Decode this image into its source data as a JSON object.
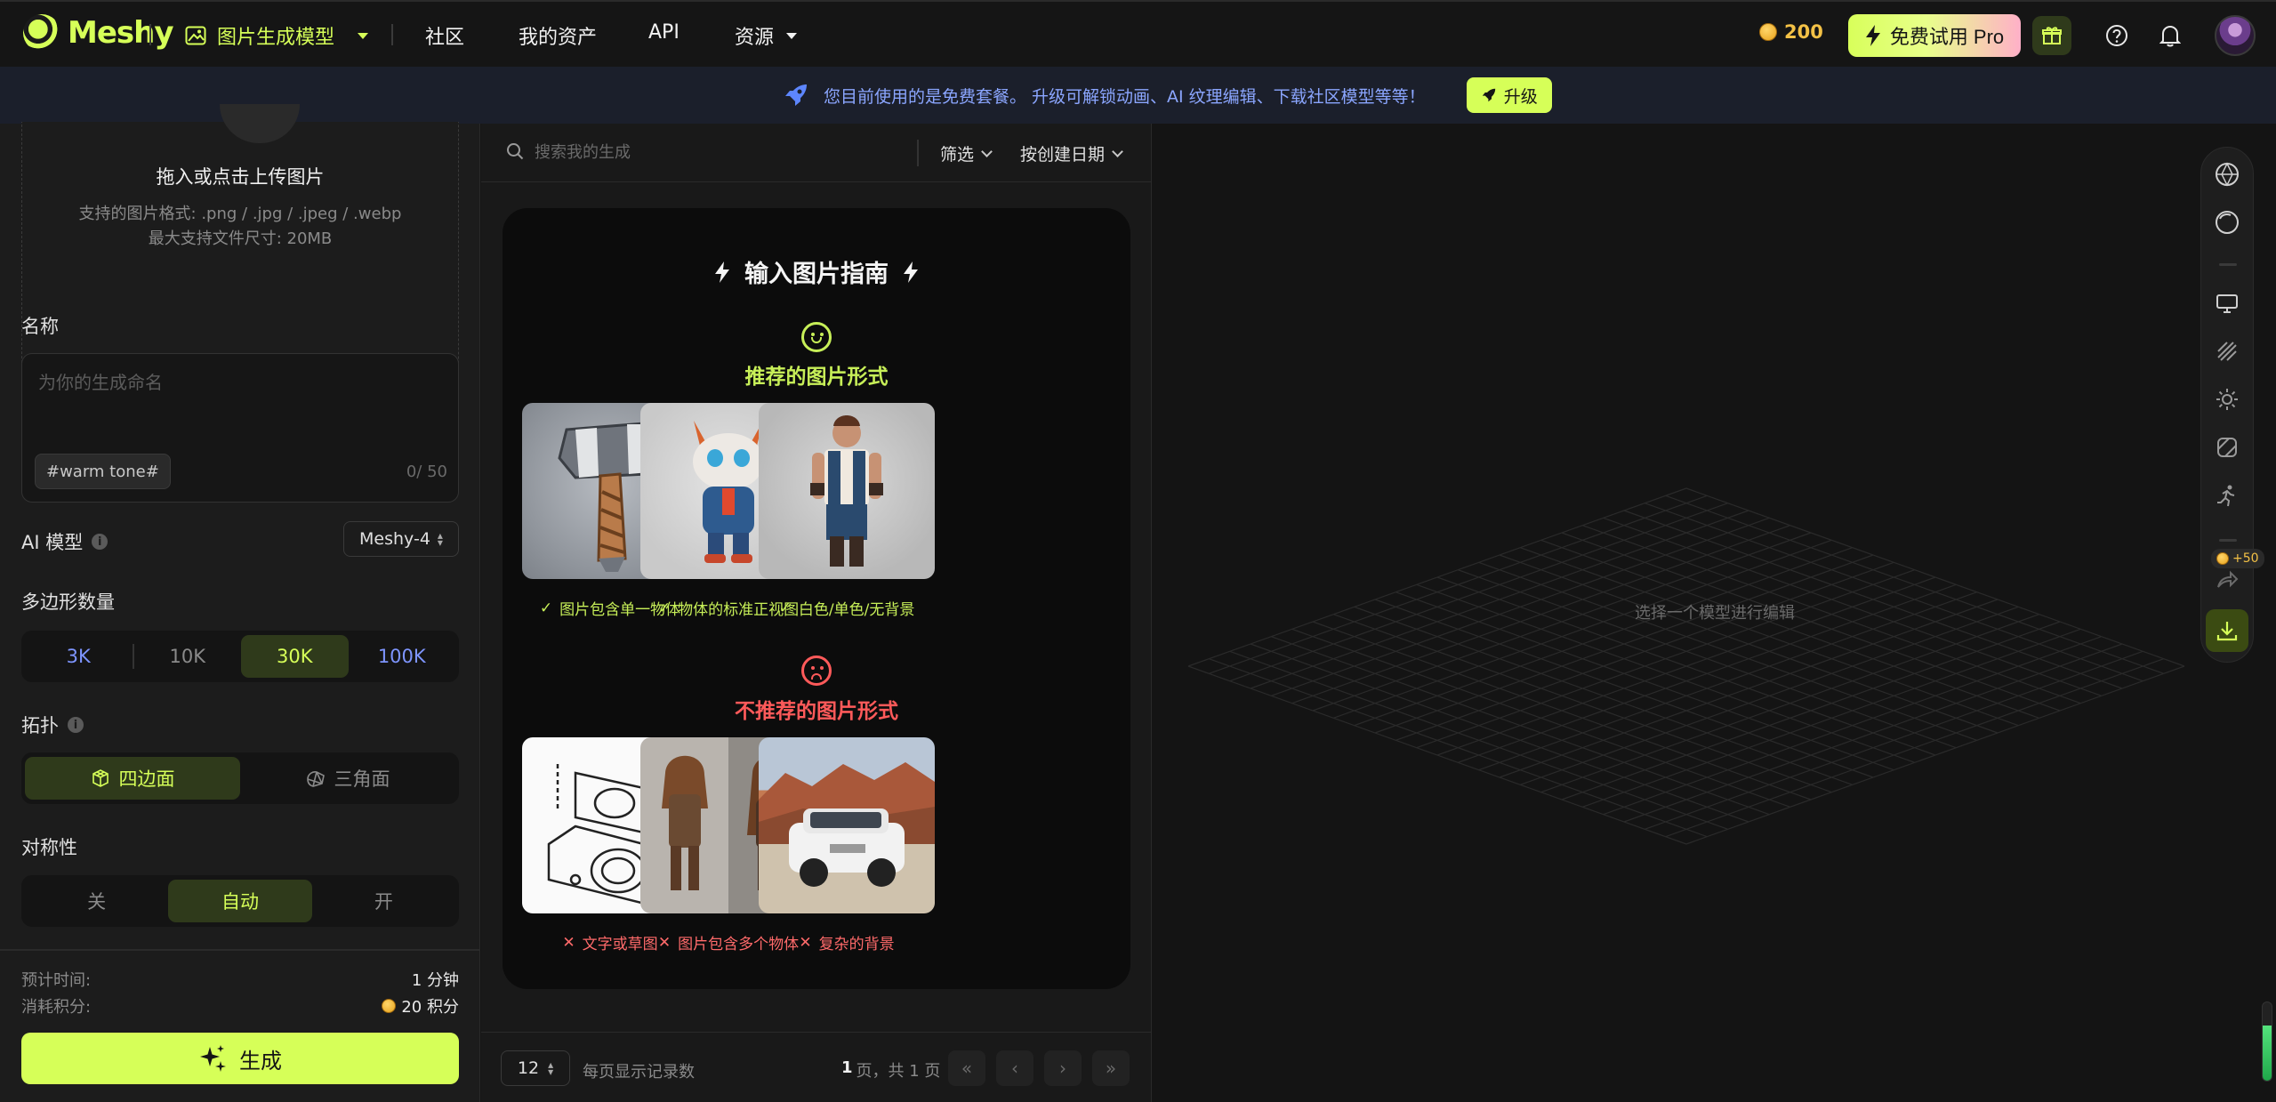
{
  "nav": {
    "logo_text": "Meshy",
    "gen_mode": "图片生成模型",
    "items": [
      "社区",
      "我的资产",
      "API",
      "资源"
    ],
    "credits": "200",
    "pro_label": "免费试用 Pro"
  },
  "banner": {
    "text": "您目前使用的是免费套餐。 升级可解锁动画、AI 纹理编辑、下载社区模型等等！",
    "upgrade_label": "升级"
  },
  "upload": {
    "title": "拖入或点击上传图片",
    "formats": "支持的图片格式: .png / .jpg / .jpeg / .webp",
    "max_size": "最大支持文件尺寸: 20MB"
  },
  "form": {
    "name_label": "名称",
    "name_placeholder": "为你的生成命名",
    "tag": "#warm tone#",
    "counter": "0/ 50",
    "ai_model_label": "AI 模型",
    "ai_model_value": "Meshy-4",
    "poly_label": "多边形数量",
    "poly_options": [
      "3K",
      "10K",
      "30K",
      "100K"
    ],
    "topology_label": "拓扑",
    "topology_options": [
      "四边面",
      "三角面"
    ],
    "symmetry_label": "对称性",
    "symmetry_options": [
      "关",
      "自动",
      "开"
    ],
    "est_time_label": "预计时间:",
    "est_time_value": "1 分钟",
    "cost_label": "消耗积分:",
    "cost_value": "20 积分",
    "generate_label": "生成"
  },
  "list": {
    "search_placeholder": "搜索我的生成",
    "filter_label": "筛选",
    "sort_label": "按创建日期",
    "guide_title": "输入图片指南",
    "good_title": "推荐的图片形式",
    "good_captions": [
      "图片包含单一物体",
      "物体的标准正视图",
      "白色/单色/无背景"
    ],
    "bad_title": "不推荐的图片形式",
    "bad_captions": [
      "文字或草图",
      "图片包含多个物体",
      "复杂的背景"
    ],
    "page_size": "12",
    "page_size_label": "每页显示记录数",
    "page_current": "1",
    "page_info_rest": "页，共 1 页"
  },
  "viewport": {
    "empty_message": "选择一个模型进行编辑",
    "credit_badge": "+50"
  },
  "colors": {
    "accent": "#d6ff58",
    "good": "#c7ef58",
    "bad": "#ff5a5a",
    "banner_text": "#8ba6ff"
  }
}
